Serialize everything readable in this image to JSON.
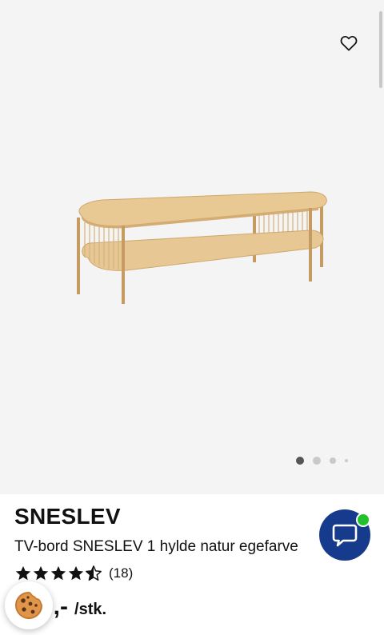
{
  "product": {
    "brand": "SNESLEV",
    "subtitle": "TV-bord SNESLEV 1 hylde natur egefarve",
    "rating_count": "(18)",
    "rating_value": 4.5,
    "rating_max": 5,
    "price": "9,-",
    "unit": "/stk."
  },
  "gallery": {
    "image_count": 4,
    "active_index": 0,
    "favorite_icon": "heart-outline-icon"
  },
  "widgets": {
    "chat_icon": "chat-bubble-icon",
    "chat_status": "online",
    "cookie_icon": "cookie-icon"
  },
  "colors": {
    "image_bg": "#f4f4f4",
    "chat_bg": "#163a8c",
    "online": "#22c22a",
    "wood": "#e3c38e"
  }
}
